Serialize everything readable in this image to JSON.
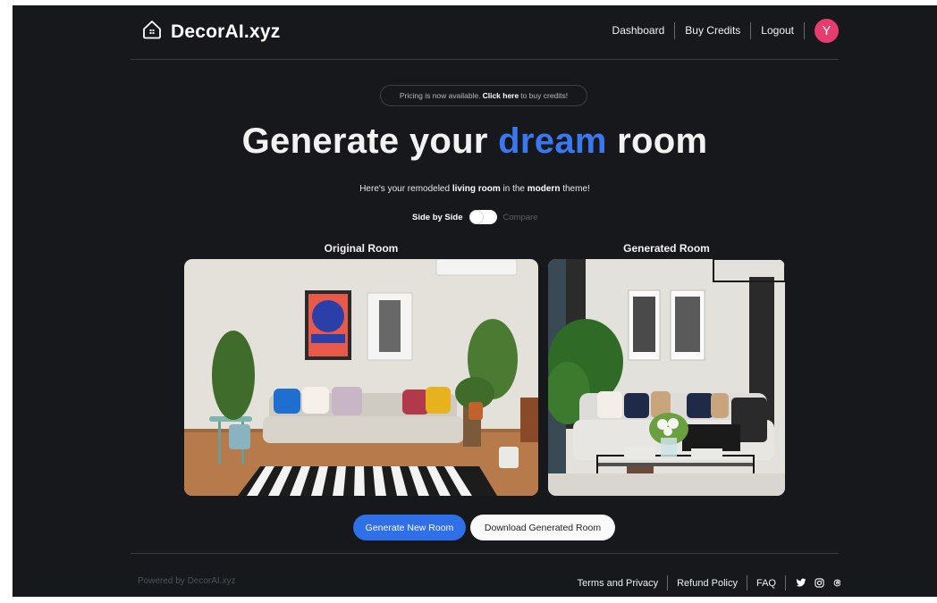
{
  "header": {
    "brand": "DecorAI.xyz",
    "logo_icon": "house-icon",
    "nav": [
      "Dashboard",
      "Buy Credits",
      "Logout"
    ],
    "avatar_initial": "Y",
    "avatar_color": "#e63c6f"
  },
  "announcement": {
    "prefix": "Pricing is now available.",
    "link": "Click here",
    "suffix": "to buy credits!"
  },
  "hero": {
    "title_start": "Generate your ",
    "title_accent": "dream",
    "title_end": " room",
    "accent_color": "#3a78f2"
  },
  "subtitle": {
    "prefix": "Here's your remodeled ",
    "room": "living room",
    "middle": " in the ",
    "theme": "modern",
    "suffix": " theme!"
  },
  "view_toggle": {
    "left_label": "Side by Side",
    "right_label": "Compare",
    "selected": "Side by Side"
  },
  "images": {
    "original_label": "Original Room",
    "generated_label": "Generated Room"
  },
  "actions": {
    "generate_new": "Generate New Room",
    "download": "Download Generated Room",
    "primary_color": "#2f6fe8"
  },
  "footer": {
    "powered_by": "Powered by DecorAI.xyz",
    "links": [
      "Terms and Privacy",
      "Refund Policy",
      "FAQ"
    ],
    "social_icons": [
      "twitter-icon",
      "instagram-icon",
      "threads-icon"
    ]
  }
}
